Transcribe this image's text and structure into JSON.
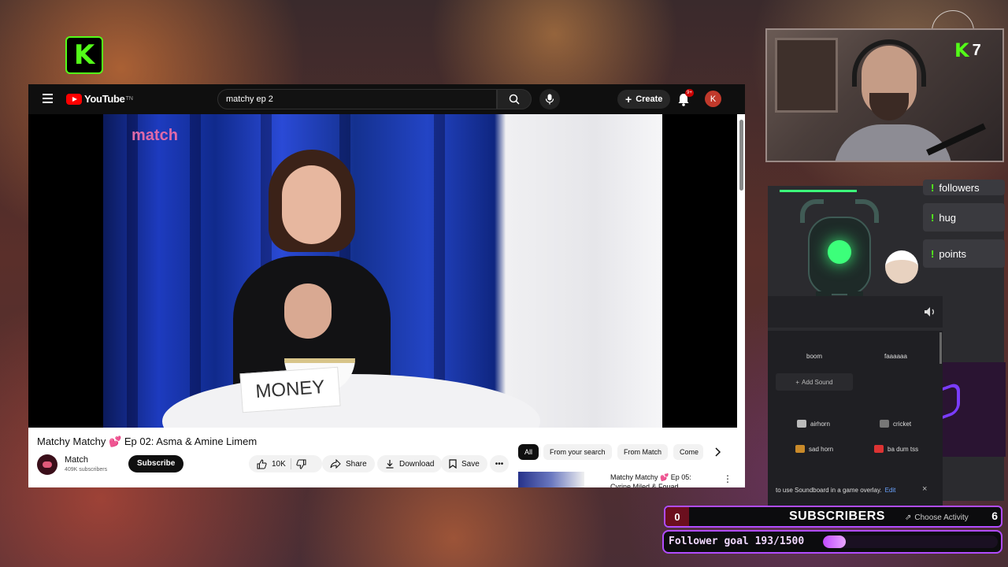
{
  "overlay": {
    "kick_logo": "K",
    "kick_viewers": "7",
    "subscribers_label": "SUBSCRIBERS",
    "subscribers_left": "0",
    "subscribers_right": "6",
    "choose_activity": "Choose Activity",
    "follower_goal_text": "Follower goal 193/1500",
    "follower_goal_fraction": 0.129,
    "accent": "#53fc18",
    "goal_color": "#b14cff"
  },
  "youtube": {
    "logo_text": "YouTube",
    "logo_sup": "TN",
    "search_value": "matchy ep 2",
    "create_label": "Create",
    "notif_badge": "9+",
    "avatar_letter": "K",
    "video": {
      "brand_text": "match",
      "card_text": "MONEY",
      "title": "Matchy Matchy 💕 Ep 02: Asma & Amine Limem"
    },
    "channel": {
      "name": "Match",
      "subs": "409K subscribers",
      "subscribe_label": "Subscribe"
    },
    "actions": {
      "like_count": "10K",
      "share": "Share",
      "download": "Download",
      "save": "Save",
      "more": "•••"
    },
    "chips": [
      "All",
      "From your search",
      "From Match",
      "Come"
    ],
    "recommended": {
      "title": "Matchy Matchy 💕 Ep 05: Cyrine Miled & Fouad",
      "more": "⋮"
    }
  },
  "soundboard": {
    "commands": [
      "followers",
      "hug",
      "points"
    ],
    "sounds": {
      "boom": "boom",
      "faaaaaaa": "faaaaaa",
      "add_sound": "Add Sound",
      "airhorn": "airhorn",
      "cricket": "cricket",
      "sad_horn": "sad horn",
      "ba_dum_tss": "ba dum tss"
    },
    "footer_text": "to use Soundboard in a game overlay.",
    "footer_edit": "Edit",
    "close": "×"
  }
}
